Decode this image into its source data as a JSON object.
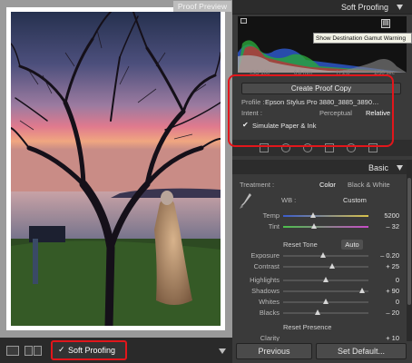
{
  "preview": {
    "label": "Proof Preview"
  },
  "soft_proofing_panel": {
    "title": "Soft Proofing",
    "tooltip": "Show Destination Gamut Warning",
    "histogram_readout": [
      "ISO 100",
      "6.8 mm",
      "f / 2.8",
      "1/50 sec"
    ],
    "create_button": "Create Proof Copy",
    "profile_label": "Profile :",
    "profile_value": "Epson Stylus Pro 3880_3885_3890…",
    "intent_label": "Intent :",
    "intent_options": [
      "Perceptual",
      "Relative"
    ],
    "intent_selected": "Relative",
    "simulate_label": "Simulate Paper & Ink",
    "simulate_checked": true
  },
  "basic_panel": {
    "title": "Basic",
    "treatment_label": "Treatment :",
    "treatment_color": "Color",
    "treatment_bw": "Black & White",
    "wb_label": "WB :",
    "wb_value": "Custom",
    "temp": {
      "label": "Temp",
      "value": "5200",
      "level": 0.35
    },
    "tint": {
      "label": "Tint",
      "value": "– 32",
      "level": 0.36
    },
    "reset_tone": "Reset Tone",
    "auto_label": "Auto",
    "exposure": {
      "label": "Exposure",
      "value": "– 0.20",
      "level": 0.47
    },
    "contrast": {
      "label": "Contrast",
      "value": "+ 25",
      "level": 0.58
    },
    "highlights": {
      "label": "Highlights",
      "value": "0",
      "level": 0.5
    },
    "shadows": {
      "label": "Shadows",
      "value": "+ 90",
      "level": 0.93
    },
    "whites": {
      "label": "Whites",
      "value": "0",
      "level": 0.5
    },
    "blacks": {
      "label": "Blacks",
      "value": "– 20",
      "level": 0.4
    },
    "reset_presence": "Reset Presence",
    "clarity": {
      "label": "Clarity",
      "value": "+ 10"
    }
  },
  "bottom": {
    "previous_label": "Previous",
    "set_default_label": "Set Default...",
    "soft_proofing_toggle": "Soft Proofing",
    "soft_proofing_checked": "✓"
  },
  "colors": {
    "highlight_red": "#e2161b",
    "panel_bg": "#3a3a3a"
  }
}
